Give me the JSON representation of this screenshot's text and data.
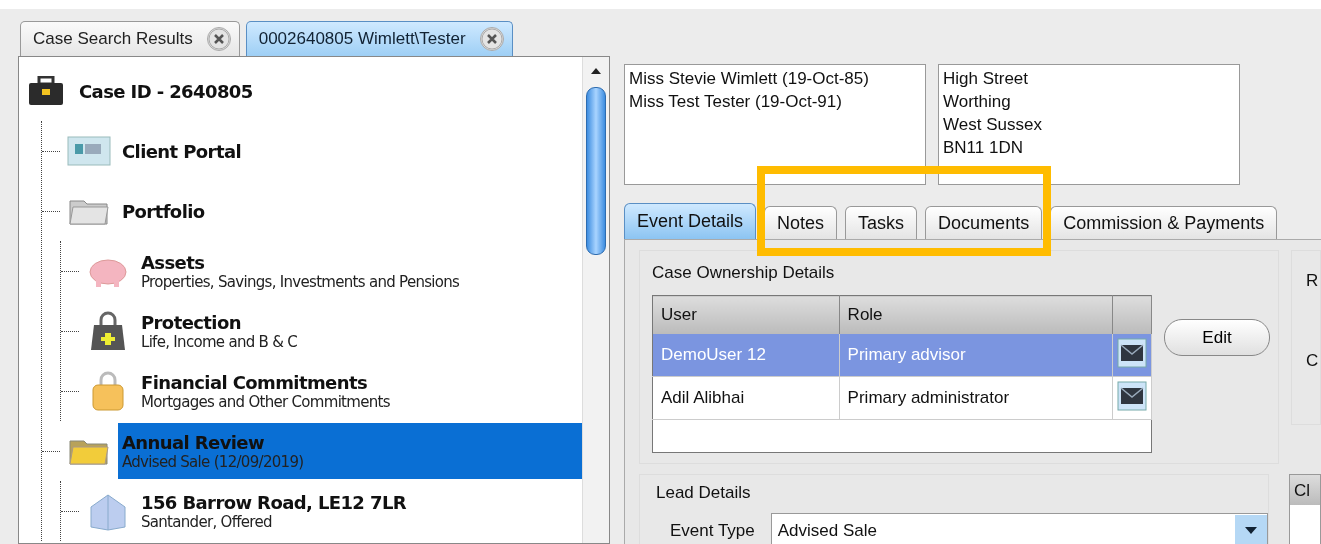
{
  "tabs": [
    {
      "label": "Case Search Results",
      "selected": false
    },
    {
      "label": "0002640805 Wimlett\\Tester",
      "selected": true
    }
  ],
  "tree": {
    "kind": "briefcase",
    "title": "Case ID - 2640805",
    "selected": false,
    "children": [
      {
        "kind": "portal",
        "title": "Client Portal",
        "selected": false
      },
      {
        "kind": "folder",
        "title": "Portfolio",
        "selected": false,
        "children": [
          {
            "kind": "assets",
            "title": "Assets",
            "subtitle": "Properties, Savings, Investments and Pensions",
            "selected": false
          },
          {
            "kind": "protection",
            "title": "Protection",
            "subtitle": "Life, Income and B & C",
            "selected": false
          },
          {
            "kind": "commitments",
            "title": "Financial Commitments",
            "subtitle": "Mortgages and Other Commitments",
            "selected": false
          }
        ]
      },
      {
        "kind": "folder-open",
        "title": "Annual Review",
        "subtitle": "Advised Sale (12/09/2019)",
        "selected": true,
        "children": [
          {
            "kind": "house",
            "title": "156 Barrow Road, LE12 7LR",
            "subtitle": "Santander, Offered",
            "selected": false
          }
        ]
      }
    ]
  },
  "parties": [
    "Miss Stevie Wimlett (19-Oct-85)",
    "Miss Test Tester (19-Oct-91)"
  ],
  "address": [
    "High Street",
    "Worthing",
    "West Sussex",
    "BN11 1DN"
  ],
  "detail_tabs": [
    {
      "label": "Event Details",
      "selected": true
    },
    {
      "label": "Notes",
      "selected": false
    },
    {
      "label": "Tasks",
      "selected": false
    },
    {
      "label": "Documents",
      "selected": false
    },
    {
      "label": "Commission & Payments",
      "selected": false
    }
  ],
  "ownership": {
    "title": "Case Ownership Details",
    "columns": [
      "User",
      "Role"
    ],
    "rows": [
      {
        "user": "DemoUser 12",
        "role": "Primary advisor",
        "selected": true
      },
      {
        "user": "Adil Alibhai",
        "role": "Primary administrator",
        "selected": false
      }
    ],
    "edit_button": "Edit"
  },
  "side_labels": [
    "R",
    "C"
  ],
  "lead": {
    "title": "Lead Details",
    "event_type_label": "Event Type",
    "event_type": "Advised Sale"
  },
  "side_table": {
    "column_1": "Cl"
  }
}
